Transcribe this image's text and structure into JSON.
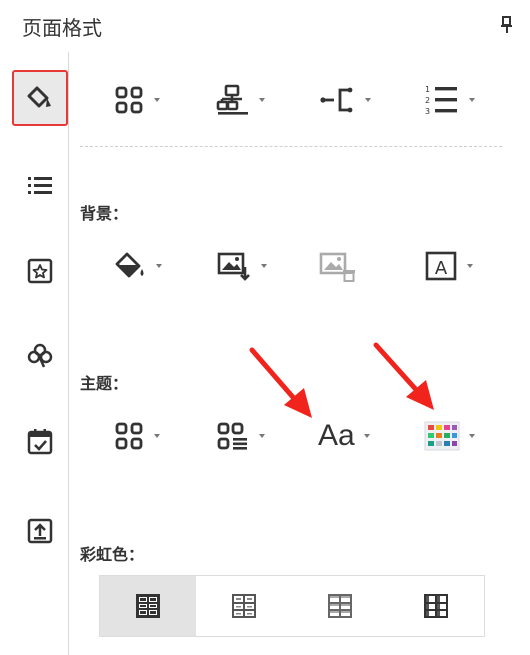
{
  "panel": {
    "title": "页面格式"
  },
  "sections": {
    "background_label": "背景：",
    "theme_label": "主题：",
    "rainbow_label": "彩虹色："
  },
  "sidebar": {
    "items": [
      {
        "icon": "paint-brush-icon",
        "active": true
      },
      {
        "icon": "list-icon",
        "active": false
      },
      {
        "icon": "badge-icon",
        "active": false
      },
      {
        "icon": "clover-icon",
        "active": false
      },
      {
        "icon": "calendar-icon",
        "active": false
      },
      {
        "icon": "export-icon",
        "active": false
      }
    ]
  },
  "layout_tools": [
    "layout-grid-icon",
    "org-structure-icon",
    "connector-icon",
    "numbered-list-icon"
  ],
  "background_tools": [
    "fill-bucket-icon",
    "background-image-icon",
    "remove-background-image-icon",
    "watermark-icon"
  ],
  "theme_tools": [
    "theme-grid-icon",
    "theme-list-icon",
    "font-icon",
    "color-scheme-icon"
  ],
  "theme_font_glyph": "Aa",
  "watermark_glyph": "A",
  "rainbow": {
    "options": 4,
    "selected_index": 0
  },
  "colors": {
    "annotation_arrow": "#f0241c",
    "active_border": "#e53935",
    "icon": "#333333"
  }
}
